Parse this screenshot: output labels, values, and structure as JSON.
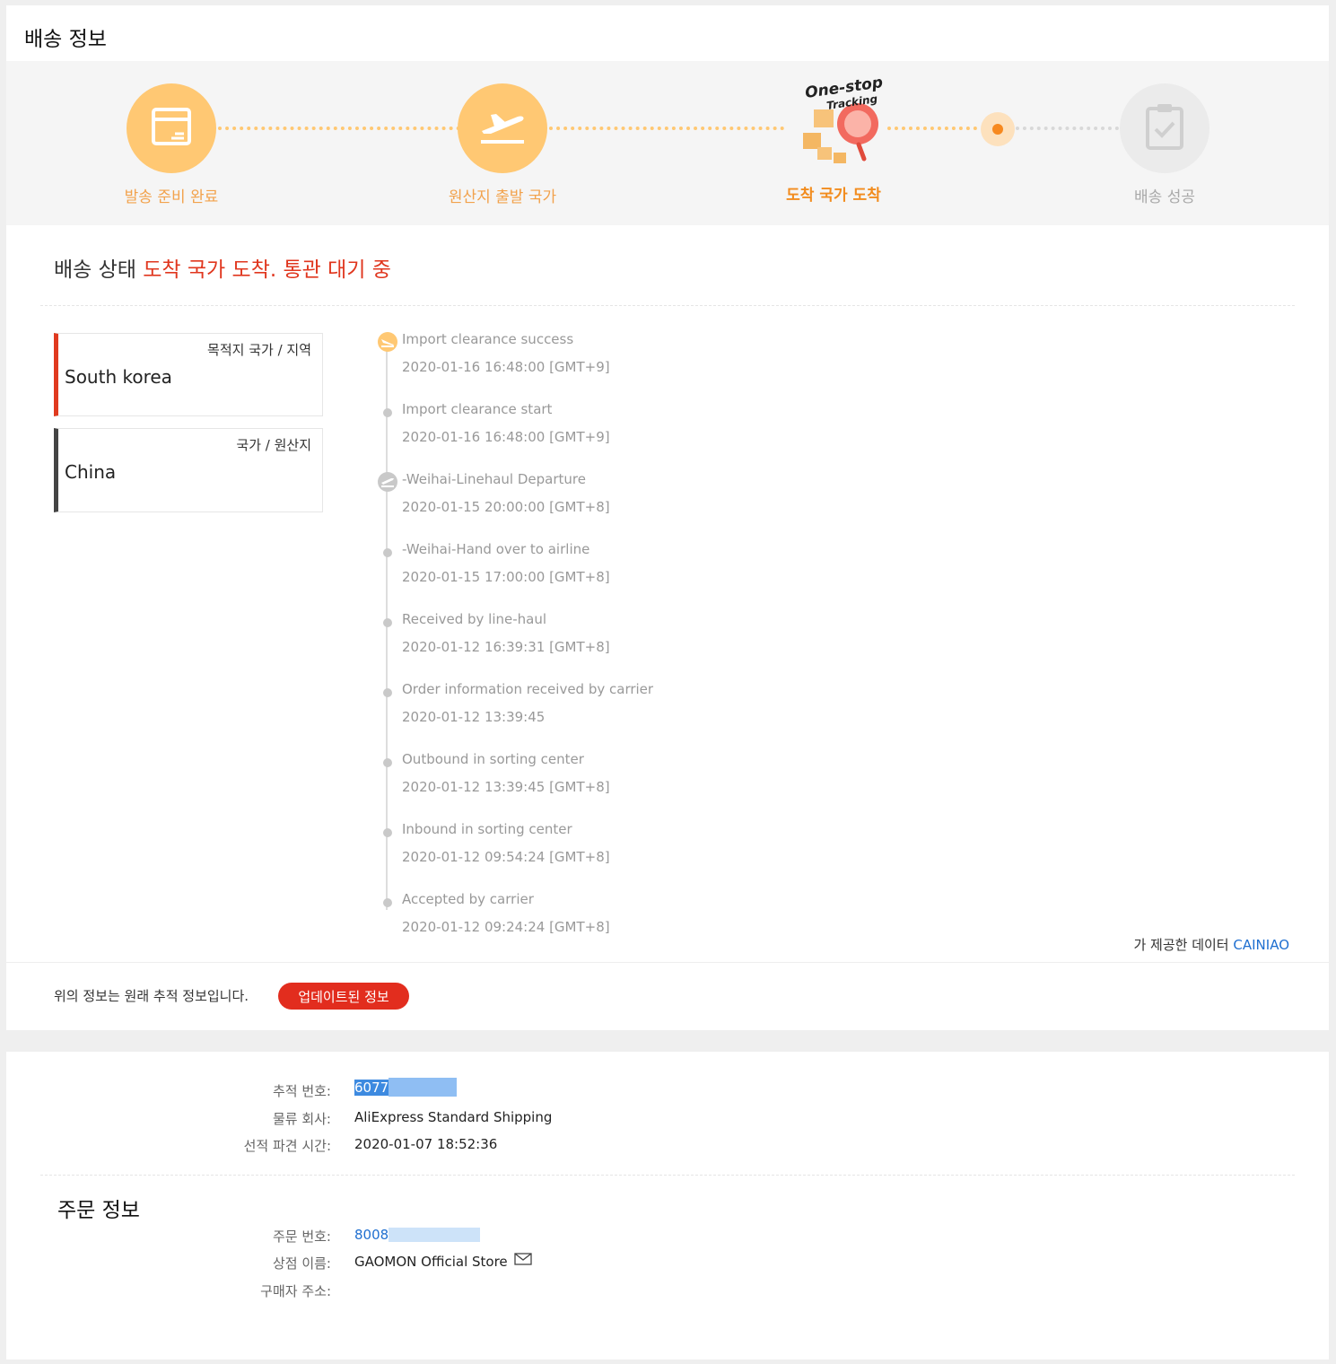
{
  "shipping": {
    "title": "배송 정보",
    "steps": [
      {
        "label": "발송 준비 완료",
        "state": "done",
        "icon": "package-icon"
      },
      {
        "label": "원산지 출발 국가",
        "state": "done",
        "icon": "plane-departure-icon"
      },
      {
        "label": "도착 국가 도착",
        "state": "current",
        "icon": "one-stop-tracking-icon"
      },
      {
        "label": "배송 성공",
        "state": "pending",
        "icon": "clipboard-check-icon"
      }
    ],
    "tracking_badge": {
      "line1": "One-stop",
      "line2": "Tracking"
    },
    "status_label": "배송 상태",
    "status_value": "도착 국가 도착. 통관 대기 중",
    "destination": {
      "label": "목적지 국가 / 지역",
      "value": "South korea"
    },
    "origin": {
      "label": "국가 / 원산지",
      "value": "China"
    },
    "events": [
      {
        "title": "Import clearance success",
        "time": "2020-01-16 16:48:00 [GMT+9]",
        "icon": "plane-landing-icon"
      },
      {
        "title": "Import clearance start",
        "time": "2020-01-16 16:48:00 [GMT+9]",
        "icon": "dot"
      },
      {
        "title": "-Weihai-Linehaul Departure",
        "time": "2020-01-15 20:00:00 [GMT+8]",
        "icon": "plane-departure-icon"
      },
      {
        "title": "-Weihai-Hand over to airline",
        "time": "2020-01-15 17:00:00 [GMT+8]",
        "icon": "dot"
      },
      {
        "title": "Received by line-haul",
        "time": "2020-01-12 16:39:31 [GMT+8]",
        "icon": "dot"
      },
      {
        "title": "Order information received by carrier",
        "time": "2020-01-12 13:39:45",
        "icon": "dot"
      },
      {
        "title": "Outbound in sorting center",
        "time": "2020-01-12 13:39:45 [GMT+8]",
        "icon": "dot"
      },
      {
        "title": "Inbound in sorting center",
        "time": "2020-01-12 09:54:24 [GMT+8]",
        "icon": "dot"
      },
      {
        "title": "Accepted by carrier",
        "time": "2020-01-12 09:24:24 [GMT+8]",
        "icon": "dot"
      }
    ],
    "provider_prefix": "가 제공한 데이터",
    "provider_name": "CAINIAO",
    "original_note": "위의 정보는 원래 추적 정보입니다.",
    "update_button": "업데이트된 정보"
  },
  "details": {
    "tracking_label": "추적 번호:",
    "tracking_value": "6077",
    "carrier_label": "물류 회사:",
    "carrier_value": "AliExpress Standard Shipping",
    "dispatch_label": "선적 파견 시간:",
    "dispatch_value": "2020-01-07 18:52:36"
  },
  "order": {
    "title": "주문 정보",
    "order_no_label": "주문 번호:",
    "order_no_value": "8008",
    "store_label": "상점 이름:",
    "store_value": "GAOMON Official Store",
    "buyer_address_label": "구매자 주소:",
    "buyer_address_value": ""
  },
  "colors": {
    "accent_orange": "#ffc873",
    "active_orange": "#f28c1e",
    "status_red": "#e0361e",
    "button_red": "#e22d1e",
    "link_blue": "#1f6fd0"
  }
}
